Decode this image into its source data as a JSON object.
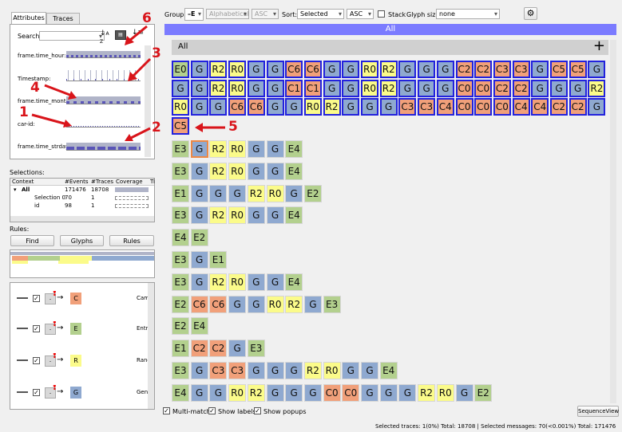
{
  "left": {
    "tabs": [
      "Attributes",
      "Traces"
    ],
    "search_label": "Search:",
    "attributes": [
      "frame.time_hour:",
      "Timestamp:",
      "frame.time_month",
      "car-id:",
      "frame.time_strday"
    ],
    "selections_label": "Selections:",
    "sel_headers": [
      "Context",
      "#Events",
      "#Traces",
      "Coverage",
      "Ti"
    ],
    "sel_rows": [
      {
        "context": "All",
        "events": "171476",
        "traces": "18708"
      },
      {
        "context": "Selection 0",
        "events": "70",
        "traces": "1"
      },
      {
        "context": "id",
        "events": "98",
        "traces": "1"
      }
    ],
    "rules_label": "Rules:",
    "rule_buttons": [
      "Find",
      "Glyphs",
      "Rules"
    ],
    "rules": [
      {
        "target": "C",
        "label": "Cam",
        "color": "#f1a07a"
      },
      {
        "target": "E",
        "label": "Entra",
        "color": "#b3d08e"
      },
      {
        "target": "R",
        "label": "Rang",
        "color": "#fbfb8a"
      },
      {
        "target": "G",
        "label": "Gene",
        "color": "#8fa9d0"
      }
    ]
  },
  "toolbar": {
    "group_label": "Group:",
    "group_icon": "E",
    "group_sort": "Alphabetical",
    "group_dir": "ASC",
    "sort_label": "Sort:",
    "sort_value": "Selected",
    "sort_dir": "ASC",
    "stack_label": "Stack",
    "glyph_size_label": "Glyph size:",
    "glyph_size_value": "none"
  },
  "main": {
    "header": "All",
    "group_title": "All",
    "plus": "+",
    "selected_rows": [
      [
        "E0",
        "G",
        "R2",
        "R0",
        "G",
        "G",
        "C6",
        "C6",
        "G",
        "G",
        "R0",
        "R2",
        "G",
        "G",
        "G",
        "C2",
        "C2",
        "C3",
        "C3",
        "G",
        "C5",
        "C5",
        "G"
      ],
      [
        "G",
        "G",
        "R2",
        "R0",
        "G",
        "G",
        "C1",
        "C1",
        "G",
        "G",
        "R0",
        "R2",
        "G",
        "G",
        "G",
        "C0",
        "C0",
        "C2",
        "C2",
        "G",
        "G",
        "G",
        "R2"
      ],
      [
        "R0",
        "G",
        "G",
        "C6",
        "C6",
        "G",
        "G",
        "R0",
        "R2",
        "G",
        "G",
        "G",
        "C3",
        "C3",
        "C4",
        "C0",
        "C0",
        "C0",
        "C4",
        "C4",
        "C2",
        "C2",
        "G"
      ],
      [
        "C5"
      ]
    ],
    "traces": [
      [
        "E3",
        "G",
        "R2",
        "R0",
        "G",
        "G",
        "E4"
      ],
      [
        "E3",
        "G",
        "R2",
        "R0",
        "G",
        "G",
        "E4"
      ],
      [
        "E1",
        "G",
        "G",
        "G",
        "R2",
        "R0",
        "G",
        "E2"
      ],
      [
        "E3",
        "G",
        "R2",
        "R0",
        "G",
        "G",
        "E4"
      ],
      [
        "E4",
        "E2"
      ],
      [
        "E3",
        "G",
        "E1"
      ],
      [
        "E3",
        "G",
        "R2",
        "R0",
        "G",
        "G",
        "E4"
      ],
      [
        "E2",
        "C6",
        "C6",
        "G",
        "G",
        "R0",
        "R2",
        "G",
        "E3"
      ],
      [
        "E2",
        "E4"
      ],
      [
        "E1",
        "C2",
        "C2",
        "G",
        "E3"
      ],
      [
        "E3",
        "G",
        "C3",
        "C3",
        "G",
        "G",
        "G",
        "R2",
        "R0",
        "G",
        "G",
        "E4"
      ],
      [
        "E4",
        "G",
        "G",
        "R0",
        "R2",
        "G",
        "G",
        "G",
        "C0",
        "C0",
        "G",
        "G",
        "G",
        "R2",
        "R0",
        "G",
        "E2"
      ]
    ]
  },
  "bottom": {
    "multimatch": "Multi-match",
    "show_labels": "Show labels",
    "show_popups": "Show popups",
    "seqview": "SequenceView",
    "status": "Selected traces: 1(0%) Total: 18708 | Selected messages: 70(<0.001%) Total: 171476"
  },
  "annotations": [
    "1",
    "2",
    "3",
    "4",
    "5",
    "6"
  ],
  "colors": {
    "G": "#8fa9d0",
    "R": "#fbfb8a",
    "C": "#f1a07a",
    "E": "#b3d08e",
    "header": "#7b7bff",
    "annotation": "#d9141a"
  }
}
